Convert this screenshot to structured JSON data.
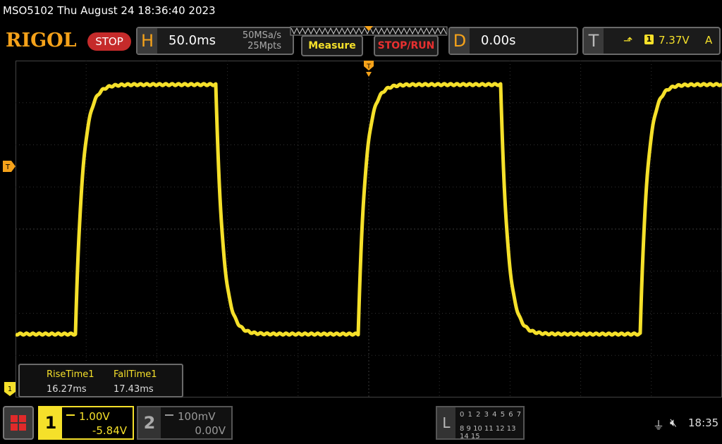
{
  "header": {
    "title": "MSO5102  Thu August 24 18:36:40 2023",
    "logo": "RIGOL",
    "run_state": "STOP"
  },
  "horizontal": {
    "letter": "H",
    "timebase": "50.0ms",
    "sample_rate": "50MSa/s",
    "memory_depth": "25Mpts"
  },
  "buttons": {
    "measure": "Measure",
    "stop_run": "STOP/RUN"
  },
  "delay": {
    "letter": "D",
    "value": "0.00s"
  },
  "trigger": {
    "letter": "T",
    "source": "1",
    "level": "7.37V",
    "mode": "A"
  },
  "markers": {
    "trigger_position": "T",
    "trigger_level": "T",
    "channel1": "1"
  },
  "measurements": {
    "items": [
      {
        "label": "RiseTime1",
        "value": "16.27ms"
      },
      {
        "label": "FallTime1",
        "value": "17.43ms"
      }
    ]
  },
  "channels": {
    "ch1": {
      "number": "1",
      "scale": "1.00V",
      "offset": "-5.84V",
      "color": "#f5e02a"
    },
    "ch2": {
      "number": "2",
      "scale": "100mV",
      "offset": "0.00V",
      "color": "#999999"
    }
  },
  "logic": {
    "letter": "L",
    "row1": "0 1 2 3  4 5 6 7",
    "row2": "8 9 10 11 12 13 14 15"
  },
  "status": {
    "clock": "18:35",
    "usb_icon": "usb-icon",
    "speaker_icon": "speaker-muted-icon"
  },
  "colors": {
    "trace": "#f5e02a",
    "accent_orange": "#f5a21a",
    "stop_red": "#c52b2b"
  }
}
